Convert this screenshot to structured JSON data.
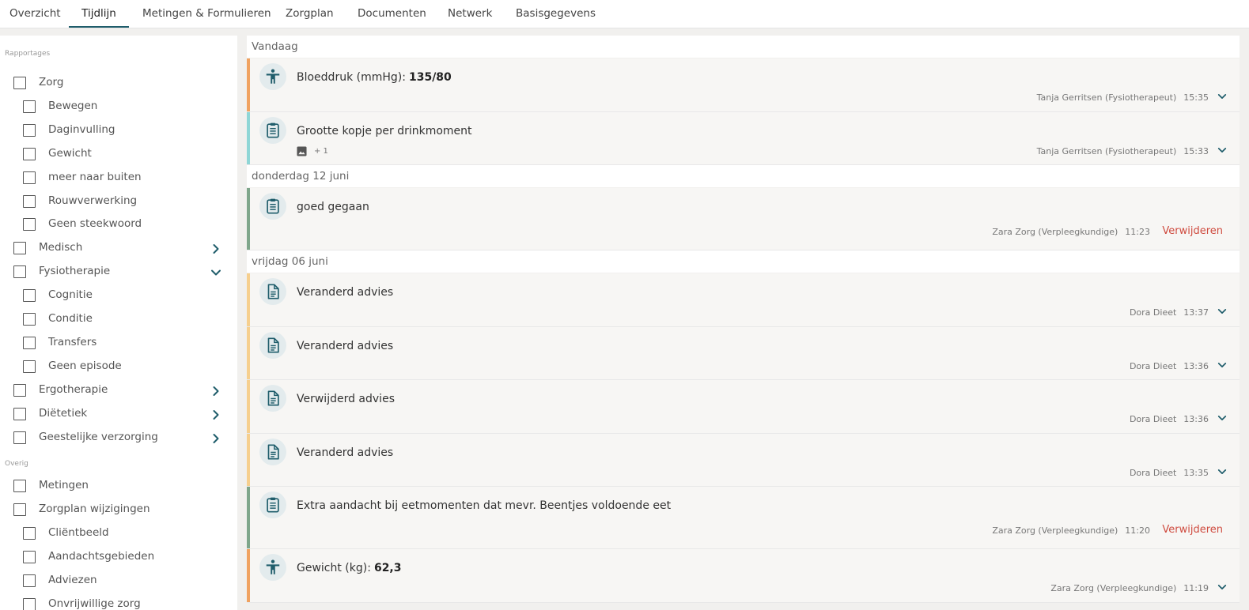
{
  "tabs": [
    "Overzicht",
    "Tijdlijn",
    "Metingen & Formulieren",
    "Zorgplan",
    "Documenten",
    "Netwerk",
    "Basisgegevens"
  ],
  "active_tab": "Tijdlijn",
  "sidebar": {
    "section_rapportages": "Rapportages",
    "section_overig": "Overig",
    "filters": [
      {
        "label": "Zorg",
        "level": 0,
        "checked": false
      },
      {
        "label": "Bewegen",
        "level": 1,
        "checked": false
      },
      {
        "label": "Daginvulling",
        "level": 1,
        "checked": false
      },
      {
        "label": "Gewicht",
        "level": 1,
        "checked": false
      },
      {
        "label": "meer naar buiten",
        "level": 1,
        "checked": false
      },
      {
        "label": "Rouwverwerking",
        "level": 1,
        "checked": false
      },
      {
        "label": "Geen steekwoord",
        "level": 1,
        "checked": false
      },
      {
        "label": "Medisch",
        "level": 0,
        "checked": false,
        "chevron": "right"
      },
      {
        "label": "Fysiotherapie",
        "level": 0,
        "checked": false,
        "chevron": "down"
      },
      {
        "label": "Cognitie",
        "level": 1,
        "checked": false
      },
      {
        "label": "Conditie",
        "level": 1,
        "checked": false
      },
      {
        "label": "Transfers",
        "level": 1,
        "checked": false
      },
      {
        "label": "Geen episode",
        "level": 1,
        "checked": false
      },
      {
        "label": "Ergotherapie",
        "level": 0,
        "checked": false,
        "chevron": "right"
      },
      {
        "label": "Diëtetiek",
        "level": 0,
        "checked": false,
        "chevron": "right"
      },
      {
        "label": "Geestelijke verzorging",
        "level": 0,
        "checked": false,
        "chevron": "right"
      }
    ],
    "overig_filters": [
      {
        "label": "Metingen",
        "level": 0,
        "checked": false
      },
      {
        "label": "Zorgplan wijzigingen",
        "level": 0,
        "checked": false
      },
      {
        "label": "Cliëntbeeld",
        "level": 1,
        "checked": false
      },
      {
        "label": "Aandachtsgebieden",
        "level": 1,
        "checked": false
      },
      {
        "label": "Adviezen",
        "level": 1,
        "checked": false
      },
      {
        "label": "Onvrijwillige zorg",
        "level": 1,
        "checked": false
      }
    ]
  },
  "timeline": {
    "groups": [
      {
        "date": "Vandaag",
        "entries": [
          {
            "icon": "person-icon",
            "title": "Bloeddruk (mmHg):",
            "value": "135/80",
            "author": "Tanja Gerritsen (Fysiotherapeut)",
            "time": "15:35",
            "color": "#f0a260",
            "action": "expand"
          },
          {
            "icon": "clipboard-icon",
            "title": "Grootte kopje per drinkmoment",
            "attachments": "+ 1",
            "author": "Tanja Gerritsen (Fysiotherapeut)",
            "time": "15:33",
            "color": "#8fd6d6",
            "action": "expand"
          }
        ]
      },
      {
        "date": "donderdag 12 juni",
        "entries": [
          {
            "icon": "clipboard-icon",
            "title": "goed gegaan",
            "author": "Zara Zorg (Verpleegkundige)",
            "time": "11:23",
            "color": "#7fa68b",
            "action": "delete",
            "action_label": "Verwijderen"
          }
        ]
      },
      {
        "date": "vrijdag 06 juni",
        "entries": [
          {
            "icon": "document-icon",
            "title": "Veranderd advies",
            "author": "Dora Dieet",
            "time": "13:37",
            "color": "#f6cf8e",
            "action": "expand"
          },
          {
            "icon": "document-icon",
            "title": "Veranderd advies",
            "author": "Dora Dieet",
            "time": "13:36",
            "color": "#f6cf8e",
            "action": "expand"
          },
          {
            "icon": "document-icon",
            "title": "Verwijderd advies",
            "author": "Dora Dieet",
            "time": "13:36",
            "color": "#f6cf8e",
            "action": "expand"
          },
          {
            "icon": "document-icon",
            "title": "Veranderd advies",
            "author": "Dora Dieet",
            "time": "13:35",
            "color": "#f6cf8e",
            "action": "expand"
          },
          {
            "icon": "clipboard-icon",
            "title": "Extra aandacht bij eetmomenten dat mevr. Beentjes voldoende eet",
            "author": "Zara Zorg (Verpleegkundige)",
            "time": "11:20",
            "color": "#7fa68b",
            "action": "delete",
            "action_label": "Verwijderen"
          },
          {
            "icon": "person-icon",
            "title": "Gewicht (kg):",
            "value": "62,3",
            "author": "Zara Zorg (Verpleegkundige)",
            "time": "11:19",
            "color": "#f0a260",
            "action": "expand"
          }
        ]
      }
    ]
  }
}
